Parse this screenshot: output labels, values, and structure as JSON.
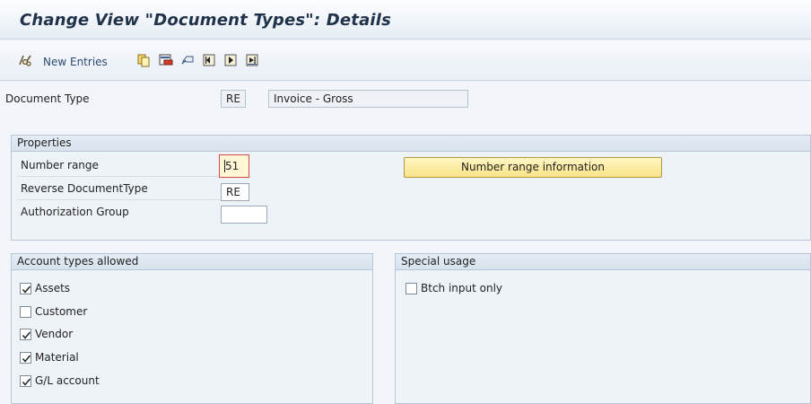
{
  "title": "Change View \"Document Types\": Details",
  "toolbar": {
    "new_entries_label": "New Entries",
    "icons": [
      "glasses-icon",
      "copy-icon",
      "delete-icon",
      "undo-icon",
      "first-entry-icon",
      "next-entry-icon",
      "last-entry-icon"
    ]
  },
  "header": {
    "doc_type_label": "Document Type",
    "doc_type_value": "RE",
    "doc_type_desc": "Invoice - Gross"
  },
  "properties": {
    "title": "Properties",
    "number_range_label": "Number range",
    "number_range_value": "51",
    "reverse_doc_type_label": "Reverse DocumentType",
    "reverse_doc_type_value": "RE",
    "auth_group_label": "Authorization Group",
    "auth_group_value": "",
    "number_range_button": "Number range information"
  },
  "account_types": {
    "title": "Account types allowed",
    "items": [
      {
        "label": "Assets",
        "checked": true
      },
      {
        "label": "Customer",
        "checked": false
      },
      {
        "label": "Vendor",
        "checked": true
      },
      {
        "label": "Material",
        "checked": true
      },
      {
        "label": "G/L account",
        "checked": true
      }
    ]
  },
  "special_usage": {
    "title": "Special usage",
    "items": [
      {
        "label": "Btch input only",
        "checked": false
      }
    ]
  },
  "colors": {
    "button_yellow": "#f9e487",
    "focus_red": "#d24a4a",
    "group_header": "#d8e3ee"
  }
}
